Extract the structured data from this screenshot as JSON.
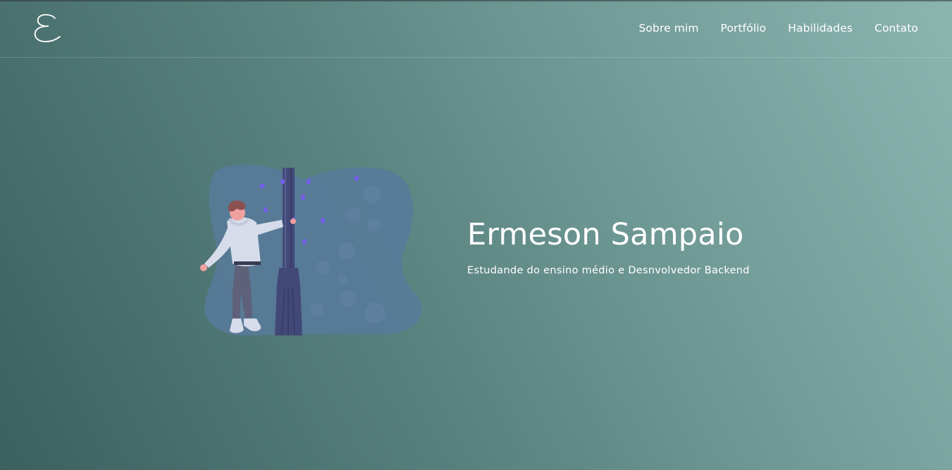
{
  "header": {
    "logo_icon": "script-letter-e-logo",
    "nav": [
      {
        "label": "Sobre mim"
      },
      {
        "label": "Portfólio"
      },
      {
        "label": "Habilidades"
      },
      {
        "label": "Contato"
      }
    ]
  },
  "hero": {
    "title": "Ermeson Sampaio",
    "subtitle": "Estudande do ensino médio e Desnvolvedor Backend",
    "illustration_icon": "person-leaning-on-lamppost-illustration"
  },
  "colors": {
    "background_dark": "#3b615f",
    "background_light": "#8cb5b0",
    "text": "#ffffff",
    "illustration_blob": "#587a99",
    "lamppost": "#424877",
    "leaves": "#7460e8",
    "hoodie": "#d6dcea",
    "pants": "#5f6079",
    "hair": "#8c5050",
    "skin": "#f1a0a0"
  }
}
